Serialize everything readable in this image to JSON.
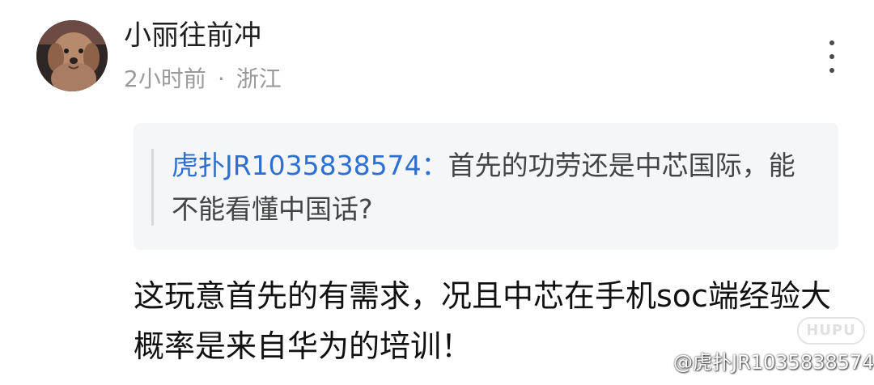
{
  "post": {
    "username": "小丽往前冲",
    "time": "2小时前",
    "separator": "·",
    "location": "浙江",
    "more_icon": "more-vertical-icon",
    "avatar_icon": "dog-avatar"
  },
  "quote": {
    "author": "虎扑JR1035838574",
    "separator": "：",
    "text": "首先的功劳还是中芯国际，能不能看懂中国话?"
  },
  "reply": {
    "text": "这玩意首先的有需求，况且中芯在手机soc端经验大概率是来自华为的培训！"
  },
  "watermark": {
    "logo": "HUPU",
    "handle": "@虎扑JR1035838574"
  },
  "colors": {
    "author_link": "#2f6fd1",
    "meta_gray": "#9a9a9a",
    "quote_bg": "#f5f6f8"
  }
}
